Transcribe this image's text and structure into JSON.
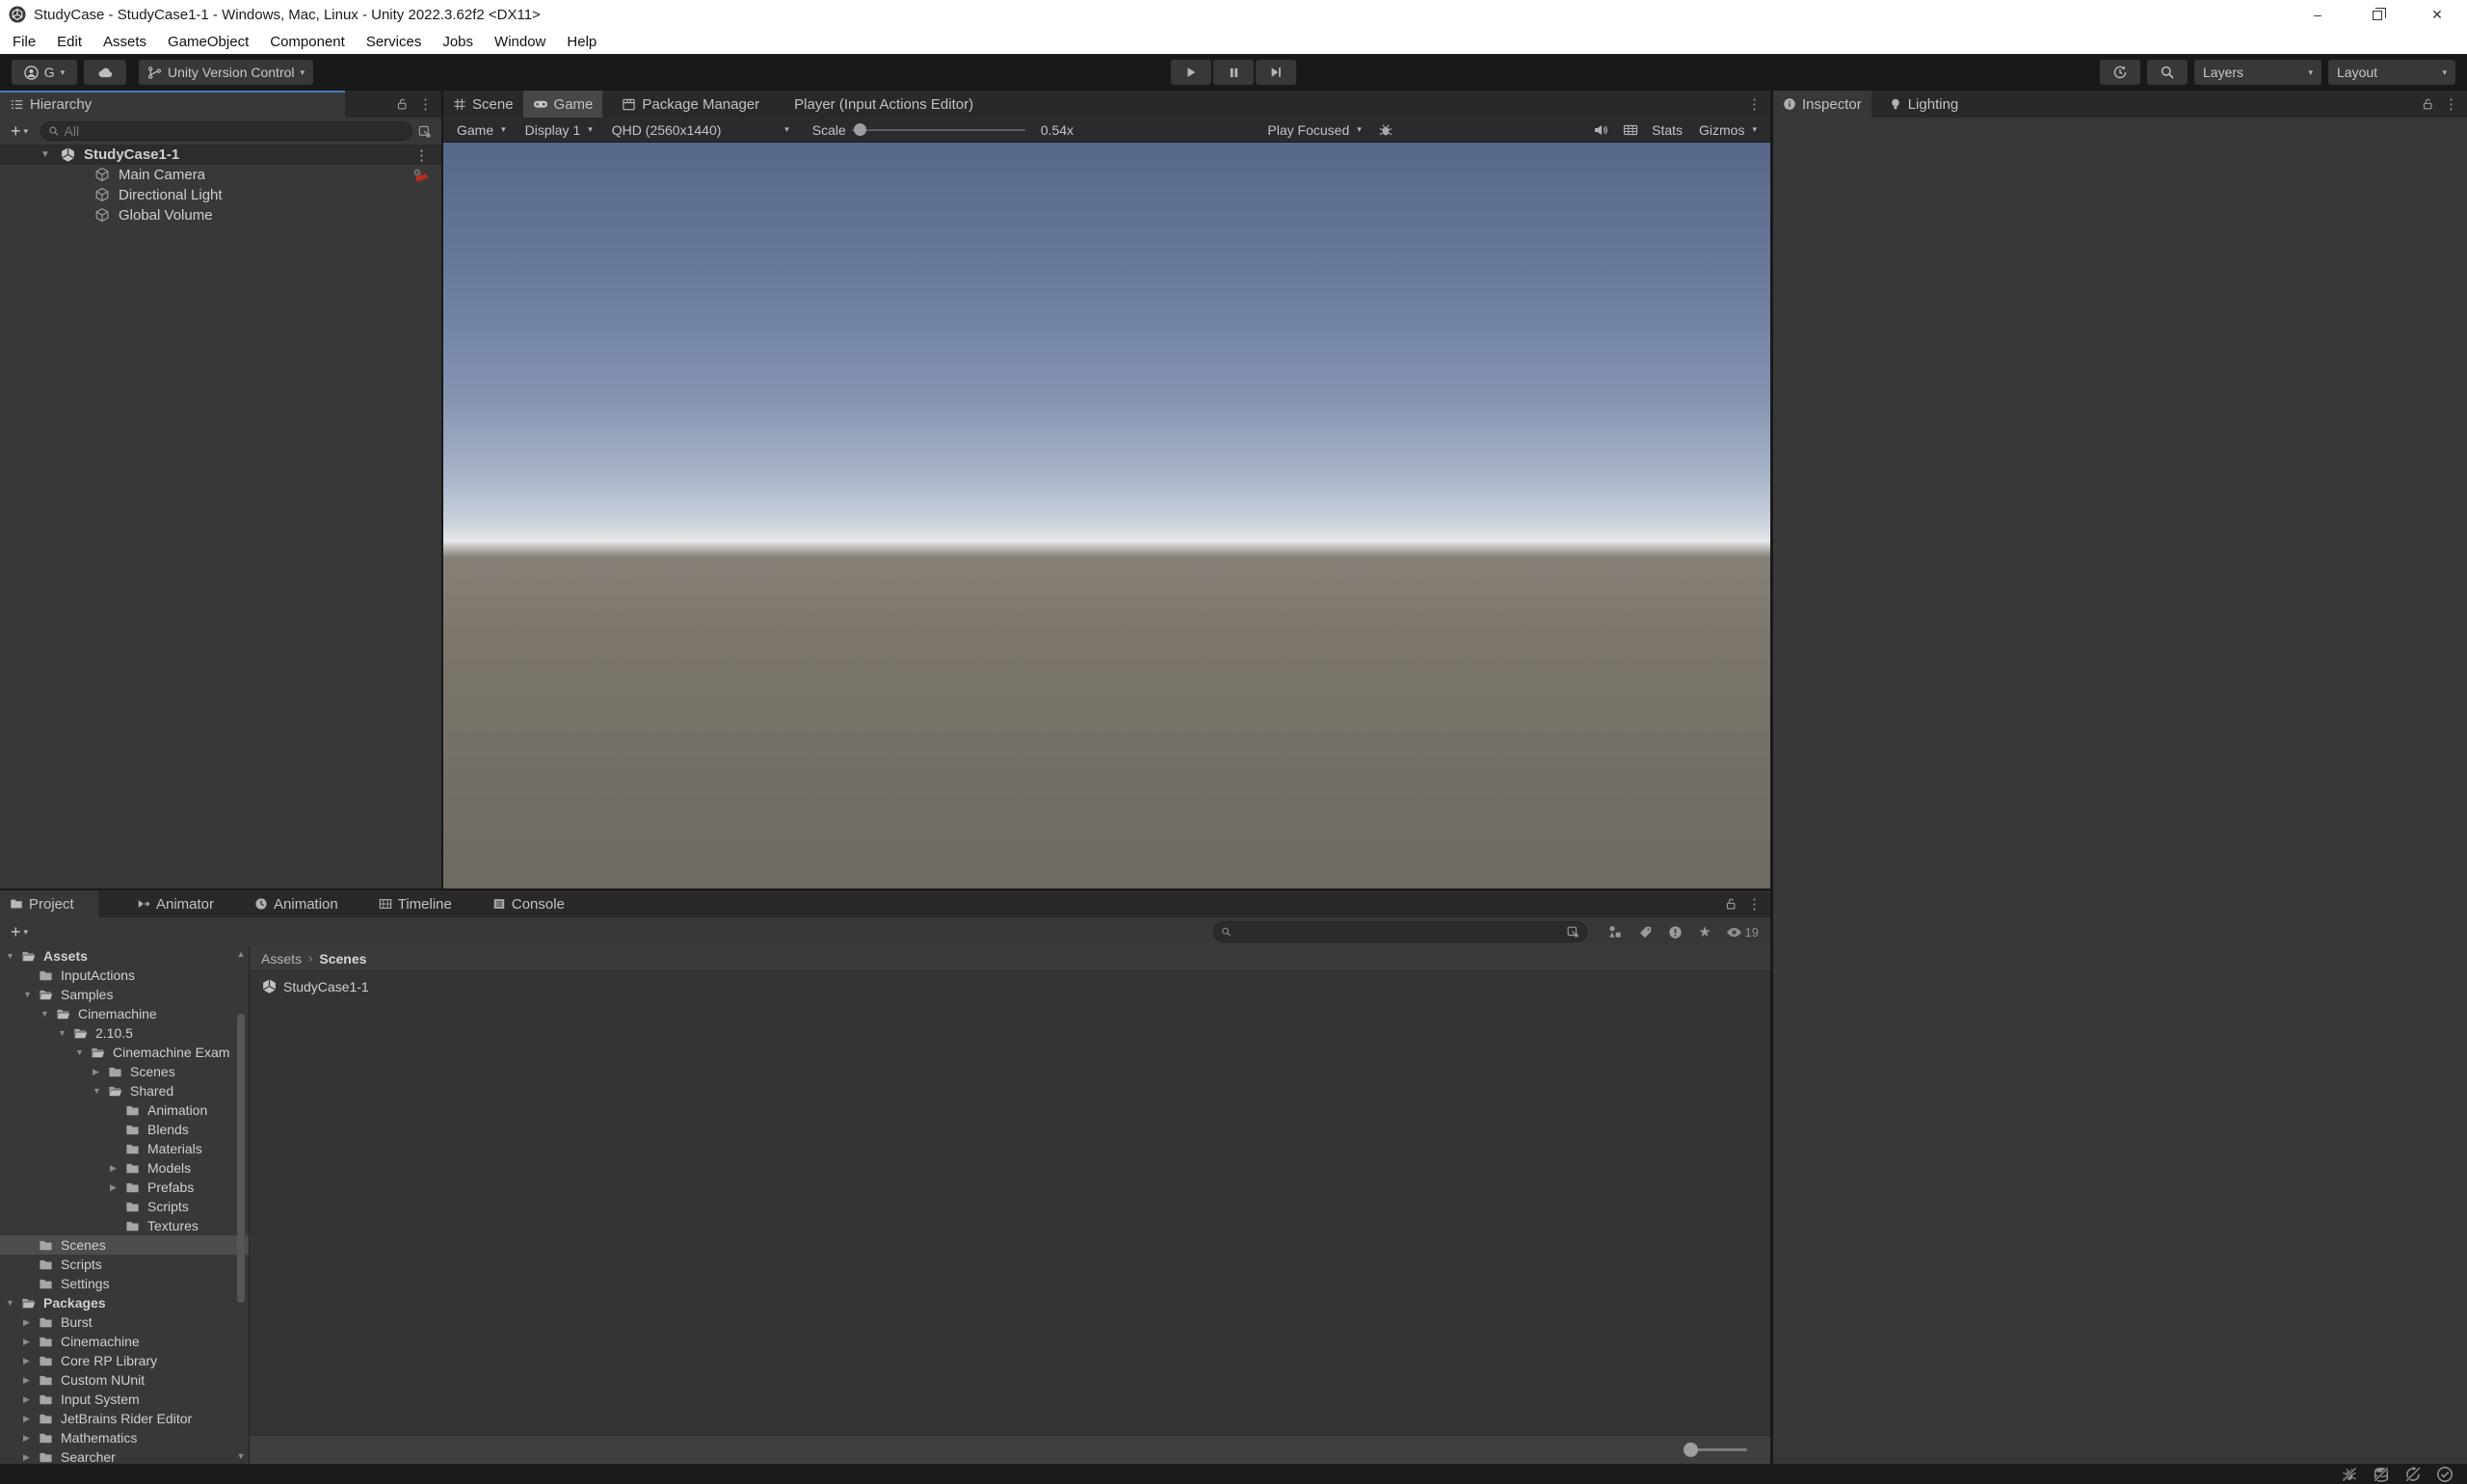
{
  "window": {
    "title": "StudyCase - StudyCase1-1 - Windows, Mac, Linux - Unity 2022.3.62f2 <DX11>",
    "controls": {
      "minimize": "–",
      "close": "✕"
    }
  },
  "menubar": {
    "items": [
      "File",
      "Edit",
      "Assets",
      "GameObject",
      "Component",
      "Services",
      "Jobs",
      "Window",
      "Help"
    ]
  },
  "toolbar": {
    "account_label": "G",
    "version_control_label": "Unity Version Control",
    "layers_label": "Layers",
    "layout_label": "Layout"
  },
  "icons": {
    "caret_glyph": "▾",
    "plus_glyph": "+",
    "kebab_glyph": "⋮",
    "star_glyph": "★"
  },
  "hierarchy": {
    "tab_label": "Hierarchy",
    "search_placeholder": "All",
    "rows": [
      {
        "label": "StudyCase1-1",
        "indent": 0,
        "arrow": "▼",
        "classes": "icon-scene scene-row trail-kebab"
      },
      {
        "label": "Main Camera",
        "indent": 1,
        "arrow": "",
        "classes": "icon-cube trail-camera"
      },
      {
        "label": "Directional Light",
        "indent": 1,
        "arrow": "",
        "classes": "icon-cube"
      },
      {
        "label": "Global Volume",
        "indent": 1,
        "arrow": "",
        "classes": "icon-cube"
      }
    ]
  },
  "center": {
    "tabs": [
      {
        "label": "Scene",
        "active": false
      },
      {
        "label": "Game",
        "active": true
      },
      {
        "label": "Package Manager",
        "active": false
      },
      {
        "label": "Player (Input Actions Editor)",
        "active": false
      }
    ]
  },
  "game_toolbar": {
    "display_mode": "Game",
    "display": "Display 1",
    "resolution": "QHD (2560x1440)",
    "scale_label": "Scale",
    "scale_value": "0.54x",
    "focus_mode": "Play Focused",
    "stats_label": "Stats",
    "gizmos_label": "Gizmos"
  },
  "inspector": {
    "tabs": [
      {
        "label": "Inspector",
        "active": true
      },
      {
        "label": "Lighting",
        "active": false
      }
    ]
  },
  "project": {
    "tabs": [
      {
        "label": "Project",
        "active": true
      },
      {
        "label": "Animator",
        "active": false
      },
      {
        "label": "Animation",
        "active": false
      },
      {
        "label": "Timeline",
        "active": false
      },
      {
        "label": "Console",
        "active": false
      }
    ],
    "visible_count": "19",
    "breadcrumb": {
      "root": "Assets",
      "separator": "›",
      "current": "Scenes"
    },
    "content_items": [
      {
        "label": "StudyCase1-1"
      }
    ],
    "tree": [
      {
        "label": "Assets",
        "indent": 0,
        "arrow": "▼",
        "classes": "icon-folder-open bold"
      },
      {
        "label": "InputActions",
        "indent": 1,
        "arrow": "",
        "classes": "icon-folder"
      },
      {
        "label": "Samples",
        "indent": 1,
        "arrow": "▼",
        "classes": "icon-folder-open"
      },
      {
        "label": "Cinemachine",
        "indent": 2,
        "arrow": "▼",
        "classes": "icon-folder-open"
      },
      {
        "label": "2.10.5",
        "indent": 3,
        "arrow": "▼",
        "classes": "icon-folder-open"
      },
      {
        "label": "Cinemachine Exam",
        "indent": 4,
        "arrow": "▼",
        "classes": "icon-folder-open"
      },
      {
        "label": "Scenes",
        "indent": 5,
        "arrow": "▶",
        "classes": "icon-folder"
      },
      {
        "label": "Shared",
        "indent": 5,
        "arrow": "▼",
        "classes": "icon-folder-open"
      },
      {
        "label": "Animation",
        "indent": 6,
        "arrow": "",
        "classes": "icon-folder"
      },
      {
        "label": "Blends",
        "indent": 6,
        "arrow": "",
        "classes": "icon-folder"
      },
      {
        "label": "Materials",
        "indent": 6,
        "arrow": "",
        "classes": "icon-folder"
      },
      {
        "label": "Models",
        "indent": 6,
        "arrow": "▶",
        "classes": "icon-folder"
      },
      {
        "label": "Prefabs",
        "indent": 6,
        "arrow": "▶",
        "classes": "icon-folder"
      },
      {
        "label": "Scripts",
        "indent": 6,
        "arrow": "",
        "classes": "icon-folder"
      },
      {
        "label": "Textures",
        "indent": 6,
        "arrow": "",
        "classes": "icon-folder"
      },
      {
        "label": "Scenes",
        "indent": 1,
        "arrow": "",
        "classes": "icon-folder selected"
      },
      {
        "label": "Scripts",
        "indent": 1,
        "arrow": "",
        "classes": "icon-folder"
      },
      {
        "label": "Settings",
        "indent": 1,
        "arrow": "",
        "classes": "icon-folder"
      },
      {
        "label": "Packages",
        "indent": 0,
        "arrow": "▼",
        "classes": "icon-folder-open bold"
      },
      {
        "label": "Burst",
        "indent": 1,
        "arrow": "▶",
        "classes": "icon-folder"
      },
      {
        "label": "Cinemachine",
        "indent": 1,
        "arrow": "▶",
        "classes": "icon-folder"
      },
      {
        "label": "Core RP Library",
        "indent": 1,
        "arrow": "▶",
        "classes": "icon-folder"
      },
      {
        "label": "Custom NUnit",
        "indent": 1,
        "arrow": "▶",
        "classes": "icon-folder"
      },
      {
        "label": "Input System",
        "indent": 1,
        "arrow": "▶",
        "classes": "icon-folder"
      },
      {
        "label": "JetBrains Rider Editor",
        "indent": 1,
        "arrow": "▶",
        "classes": "icon-folder"
      },
      {
        "label": "Mathematics",
        "indent": 1,
        "arrow": "▶",
        "classes": "icon-folder"
      },
      {
        "label": "Searcher",
        "indent": 1,
        "arrow": "▶",
        "classes": "icon-folder"
      }
    ]
  },
  "statusbar": {
    "icons": [
      "bug-disabled-icon",
      "cache-server-disconnected-icon",
      "auto-refresh-off-icon",
      "progress-ok-icon"
    ]
  },
  "colors": {
    "accent": "#4a80b8",
    "selection": "#4d4d4d",
    "panel": "#383838",
    "dark": "#191919",
    "sky_top": "#57678a",
    "sky_mid": "#a9b5c9",
    "horizon": "#e6e9eb",
    "ground_top": "#868078",
    "ground_bottom": "#6e6961"
  }
}
